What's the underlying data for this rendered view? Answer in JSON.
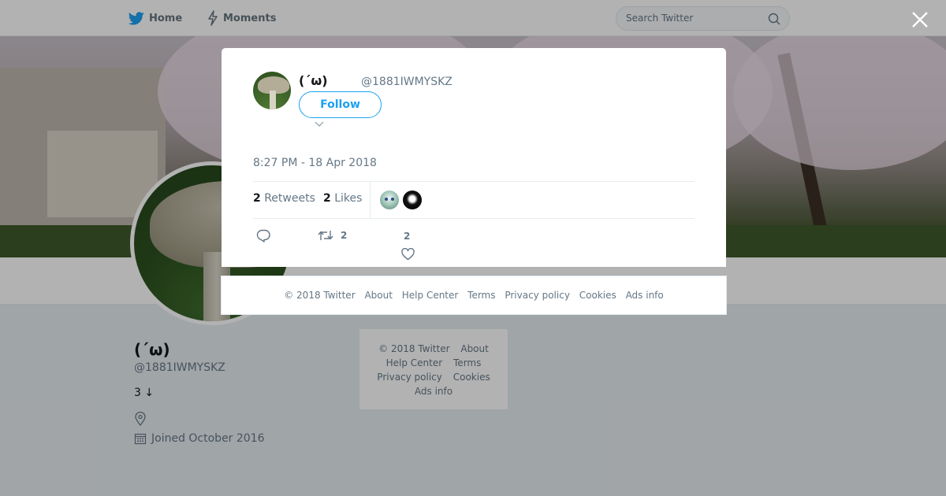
{
  "nav": {
    "home_label": "Home",
    "moments_label": "Moments",
    "search_placeholder": "Search Twitter"
  },
  "profile": {
    "name": "(´ω)",
    "handle": "@1881IWMYSKZ",
    "bio": "3 ↓",
    "joined": "Joined October 2016"
  },
  "side_footer": {
    "links": [
      "© 2018 Twitter",
      "About",
      "Help Center",
      "Terms",
      "Privacy policy",
      "Cookies",
      "Ads info"
    ]
  },
  "tweet": {
    "author_name": "(´ω)",
    "author_handle": "@1881IWMYSKZ",
    "follow_label": "Follow",
    "text": "",
    "timestamp": "8:27 PM - 18 Apr 2018",
    "retweet_count": "2",
    "retweet_label": "Retweets",
    "like_count": "2",
    "like_label": "Likes",
    "action_retweet_count": "2",
    "action_like_count": "2"
  },
  "modal_footer": {
    "links": [
      "© 2018 Twitter",
      "About",
      "Help Center",
      "Terms",
      "Privacy policy",
      "Cookies",
      "Ads info"
    ]
  },
  "colors": {
    "accent": "#1da1f2",
    "muted_text": "#657786",
    "primary_text": "#14171a"
  },
  "icons": {
    "home": "bird-icon",
    "moments": "lightning-icon",
    "search": "search-icon",
    "close": "close-icon",
    "reply": "reply-icon",
    "retweet": "retweet-icon",
    "like": "heart-icon",
    "location": "location-icon",
    "calendar": "calendar-icon"
  }
}
